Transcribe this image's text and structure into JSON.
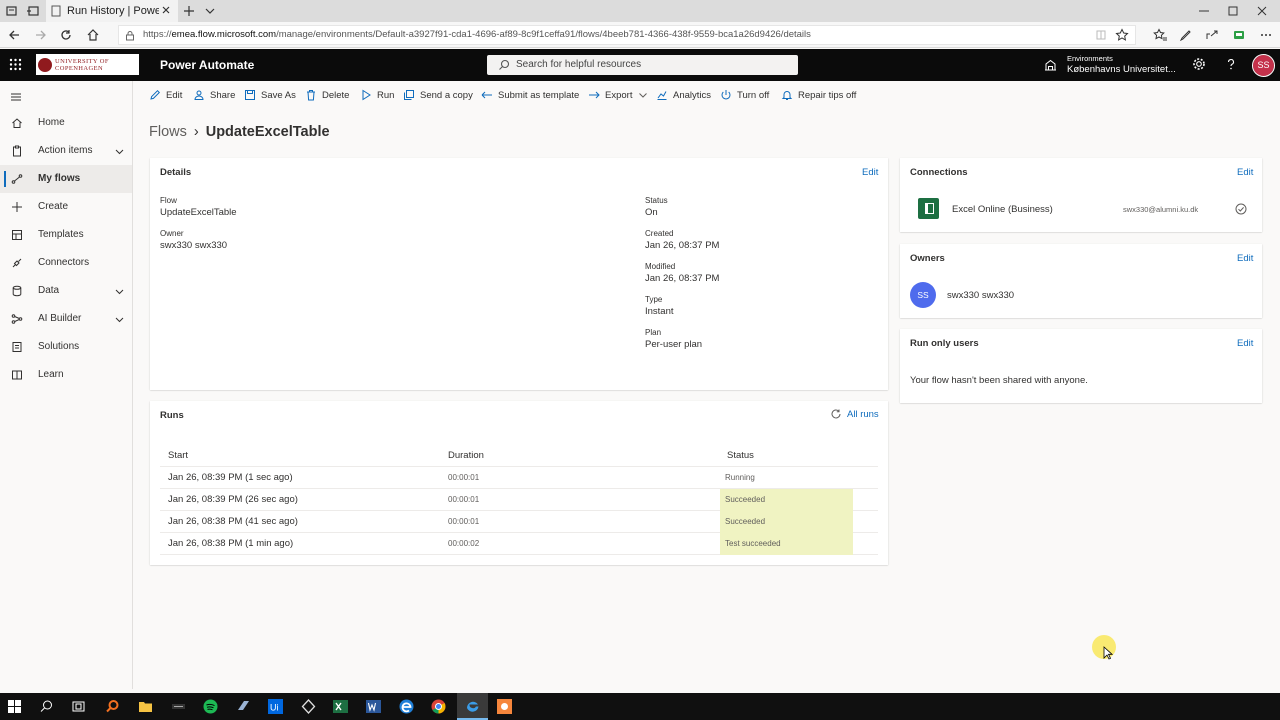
{
  "browser": {
    "tab_title": "Run History | Power Aut",
    "url_prefix": "https://",
    "url_host": "emea.flow.microsoft.com",
    "url_path": "/manage/environments/Default-a3927f91-cda1-4696-af89-8c9f1ceffa91/flows/4beeb781-4366-438f-9559-bca1a26d9426/details"
  },
  "header": {
    "logo_text_line1": "University of",
    "logo_text_line2": "Copenhagen",
    "brand": "Power Automate",
    "search_placeholder": "Search for helpful resources",
    "env_label": "Environments",
    "env_name": "Københavns Universitet...",
    "avatar_initials": "SS"
  },
  "sidebar": {
    "items": [
      {
        "label": "Home",
        "icon": "home-icon"
      },
      {
        "label": "Action items",
        "icon": "clipboard-icon",
        "expandable": true
      },
      {
        "label": "My flows",
        "icon": "flow-icon",
        "active": true
      },
      {
        "label": "Create",
        "icon": "plus-icon"
      },
      {
        "label": "Templates",
        "icon": "templates-icon"
      },
      {
        "label": "Connectors",
        "icon": "connector-icon"
      },
      {
        "label": "Data",
        "icon": "database-icon",
        "expandable": true
      },
      {
        "label": "AI Builder",
        "icon": "ai-builder-icon",
        "expandable": true
      },
      {
        "label": "Solutions",
        "icon": "solutions-icon"
      },
      {
        "label": "Learn",
        "icon": "book-icon"
      }
    ]
  },
  "commands": {
    "edit": "Edit",
    "share": "Share",
    "save_as": "Save As",
    "delete": "Delete",
    "run": "Run",
    "send_copy": "Send a copy",
    "submit_template": "Submit as template",
    "export": "Export",
    "analytics": "Analytics",
    "turn_off": "Turn off",
    "repair_tips": "Repair tips off"
  },
  "breadcrumb": {
    "root": "Flows",
    "separator": "›",
    "current": "UpdateExcelTable"
  },
  "details": {
    "title": "Details",
    "edit": "Edit",
    "flow_label": "Flow",
    "flow_value": "UpdateExcelTable",
    "owner_label": "Owner",
    "owner_value": "swx330 swx330",
    "status_label": "Status",
    "status_value": "On",
    "created_label": "Created",
    "created_value": "Jan 26, 08:37 PM",
    "modified_label": "Modified",
    "modified_value": "Jan 26, 08:37 PM",
    "type_label": "Type",
    "type_value": "Instant",
    "plan_label": "Plan",
    "plan_value": "Per-user plan"
  },
  "runs": {
    "title": "Runs",
    "all_runs": "All runs",
    "col_start": "Start",
    "col_duration": "Duration",
    "col_status": "Status",
    "rows": [
      {
        "start": "Jan 26, 08:39 PM (1 sec ago)",
        "duration": "00:00:01",
        "status": "Running"
      },
      {
        "start": "Jan 26, 08:39 PM (26 sec ago)",
        "duration": "00:00:01",
        "status": "Succeeded"
      },
      {
        "start": "Jan 26, 08:38 PM (41 sec ago)",
        "duration": "00:00:01",
        "status": "Succeeded"
      },
      {
        "start": "Jan 26, 08:38 PM (1 min ago)",
        "duration": "00:00:02",
        "status": "Test succeeded"
      }
    ]
  },
  "connections": {
    "title": "Connections",
    "edit": "Edit",
    "name": "Excel Online (Business)",
    "account": "swx330@alumni.ku.dk"
  },
  "owners": {
    "title": "Owners",
    "edit": "Edit",
    "initials": "SS",
    "name": "swx330 swx330"
  },
  "run_only": {
    "title": "Run only users",
    "edit": "Edit",
    "message": "Your flow hasn't been shared with anyone."
  },
  "colors": {
    "accent": "#0f6cbd",
    "header_bg": "#0b0b0b",
    "success_highlight": "#f0f3c2",
    "avatar": "#c4314b",
    "owner_avatar": "#4f6bed",
    "excel": "#1d6f42"
  }
}
